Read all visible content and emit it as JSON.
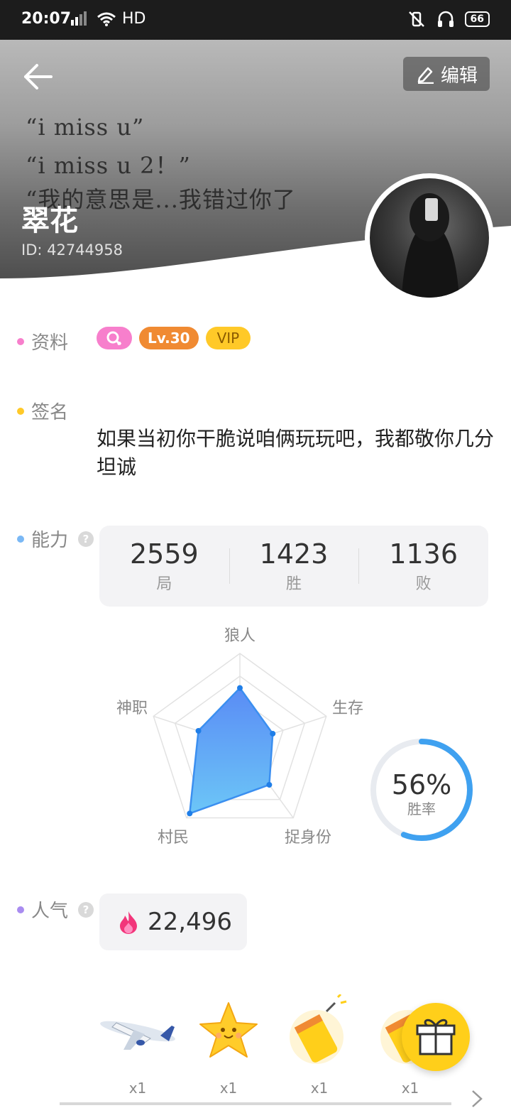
{
  "status_bar": {
    "time": "20:07",
    "network": "HD",
    "battery": "66"
  },
  "header": {
    "lyrics": [
      "“i miss u”",
      "“i miss u 2！”",
      "“我的意思是...我错过你了"
    ],
    "edit_label": "编辑",
    "nickname": "翠花",
    "user_id": "ID: 42744958"
  },
  "profile": {
    "label": "资料",
    "badges": [
      {
        "icon": "female-icon",
        "color": "#f77fcc"
      },
      {
        "text": "Lv.30",
        "color": "#f08a32"
      },
      {
        "text": "VIP",
        "color": "#ffc928"
      }
    ]
  },
  "signature": {
    "label": "签名",
    "text": "如果当初你干脆说咱俩玩玩吧，我都敬你几分坦诚"
  },
  "ability": {
    "label": "能力",
    "stats": [
      {
        "value": "2559",
        "label": "局"
      },
      {
        "value": "1423",
        "label": "胜"
      },
      {
        "value": "1136",
        "label": "败"
      }
    ],
    "radar": {
      "axes": [
        "狼人",
        "生存",
        "捉身份",
        "村民",
        "神职"
      ],
      "values": [
        0.62,
        0.38,
        0.55,
        0.94,
        0.48
      ]
    },
    "win_rate": {
      "value": "56%",
      "label": "胜率",
      "fraction": 0.56
    }
  },
  "popularity": {
    "label": "人气",
    "value": "22,496"
  },
  "gifts": [
    {
      "icon": "airplane-icon",
      "count": "x1"
    },
    {
      "icon": "star-icon",
      "count": "x1"
    },
    {
      "icon": "firecracker-icon",
      "count": "x1"
    },
    {
      "icon": "firecracker-icon",
      "count": "x1"
    }
  ],
  "colors": {
    "accent_blue": "#3fa1f0",
    "dot_pink": "#f77fcc",
    "dot_yellow": "#ffc928",
    "dot_blue": "#7ab8f5",
    "dot_purple": "#a98cf0"
  }
}
